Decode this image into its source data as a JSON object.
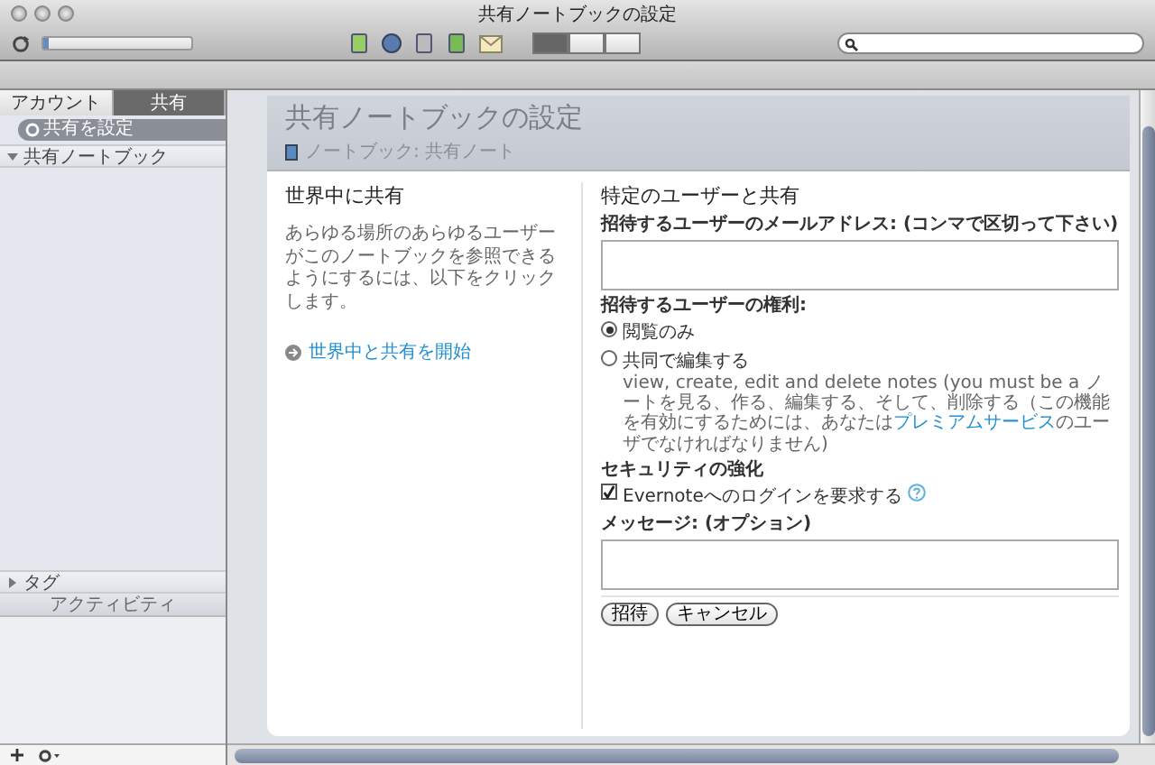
{
  "window": {
    "title": "共有ノートブックの設定"
  },
  "toolbar": {
    "sync_progress": {
      "level": 0.04
    },
    "view_modes": [
      {
        "selected": true
      },
      {
        "selected": false
      },
      {
        "selected": false
      }
    ]
  },
  "sidebar": {
    "tabs": [
      {
        "label": "アカウント",
        "selected": false
      },
      {
        "label": "共有",
        "selected": true
      }
    ],
    "action": "共有を設定",
    "sections": [
      {
        "label": "共有ノートブック",
        "expanded": true
      },
      {
        "label": "タグ",
        "expanded": false
      }
    ],
    "activity": "アクティビティ"
  },
  "page": {
    "title": "共有ノートブックの設定",
    "breadcrumb": "ノートブック: 共有ノート",
    "public": {
      "heading": "世界中に共有",
      "description": "あらゆる場所のあらゆるユーザーがこのノートブックを参照できるようにするには、以下をクリックします。",
      "link": "世界中と共有を開始"
    },
    "private": {
      "heading": "特定のユーザーと共有",
      "email_label": "招待するユーザーのメールアドレス: (コンマで区切って下さい)",
      "rights_label": "招待するユーザーの権利:",
      "rights": [
        {
          "label": "閲覧のみ",
          "selected": true
        },
        {
          "label": "共同で編集する",
          "selected": false,
          "description": [
            "view, create, edit and delete notes (you must be a ノートを見る、作る、編集する、そして、削除する（この機能を有効にするためには、あなたは",
            "プレミアムサービス",
            "のユーザでなければなりません)"
          ]
        }
      ],
      "security_label": "セキュリティの強化",
      "login_check": {
        "label": "Evernoteへのログインを要求する",
        "checked": true
      },
      "message_label": "メッセージ: (オプション)",
      "buttons": [
        "招待",
        "キャンセル"
      ]
    }
  }
}
